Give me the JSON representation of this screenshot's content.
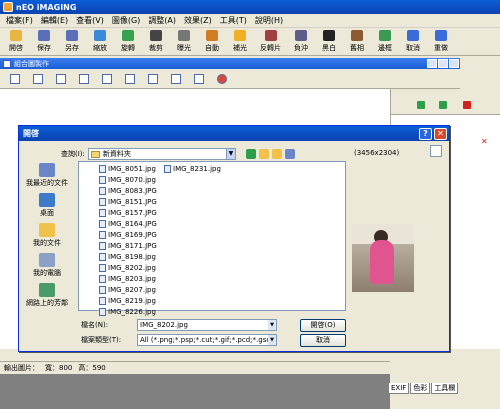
{
  "window": {
    "title": "nEO iMAGING"
  },
  "menu": [
    "檔案(F)",
    "編輯(E)",
    "查看(V)",
    "圖像(G)",
    "調整(A)",
    "效果(Z)",
    "工具(T)",
    "說明(H)"
  ],
  "toolbar": [
    {
      "label": "開啓",
      "icon": "open-folder-icon",
      "color": "#e8b640"
    },
    {
      "label": "保存",
      "icon": "save-icon",
      "color": "#5a6fb8"
    },
    {
      "label": "另存",
      "icon": "save-as-icon",
      "color": "#5a6fb8"
    },
    {
      "label": "縮放",
      "icon": "zoom-icon",
      "color": "#3b8ad9"
    },
    {
      "label": "旋轉",
      "icon": "rotate-icon",
      "color": "#37a24e"
    },
    {
      "label": "裁剪",
      "icon": "crop-icon",
      "color": "#444444"
    },
    {
      "label": "曝光",
      "icon": "exposure-icon",
      "color": "#777777"
    },
    {
      "label": "自動",
      "icon": "auto-icon",
      "color": "#d17d22"
    },
    {
      "label": "補光",
      "icon": "fill-light-icon",
      "color": "#f0b024"
    },
    {
      "label": "反轉片",
      "icon": "slide-film-icon",
      "color": "#a04040"
    },
    {
      "label": "負沖",
      "icon": "cross-process-icon",
      "color": "#5d5d8c"
    },
    {
      "label": "黑白",
      "icon": "black-white-icon",
      "color": "#222222"
    },
    {
      "label": "舊相",
      "icon": "old-photo-icon",
      "color": "#8c5a30"
    },
    {
      "label": "邊框",
      "icon": "border-icon",
      "color": "#3b9a52"
    },
    {
      "label": "取消",
      "icon": "undo-icon",
      "color": "#3b6ad9"
    },
    {
      "label": "重做",
      "icon": "redo-icon",
      "color": "#3b6ad9"
    }
  ],
  "child_window": {
    "title": "組合圖製作"
  },
  "dialog": {
    "title": "開啓",
    "lookin_label": "查詢(I):",
    "folder": "新資料夾",
    "image_size": "(3456x2304)",
    "places": [
      {
        "label": "我最近的文件",
        "icon": "recent-documents-icon",
        "color": "#6a86c8"
      },
      {
        "label": "桌面",
        "icon": "desktop-icon",
        "color": "#3d7ac8"
      },
      {
        "label": "我的文件",
        "icon": "my-documents-icon",
        "color": "#f0c24a"
      },
      {
        "label": "我的電腦",
        "icon": "my-computer-icon",
        "color": "#8aa0c8"
      },
      {
        "label": "網路上的芳鄰",
        "icon": "network-icon",
        "color": "#4a9a6a"
      }
    ],
    "files_col1": [
      "IMG_8051.jpg",
      "IMG_8070.jpg",
      "IMG_8083.JPG",
      "IMG_8151.JPG",
      "IMG_8157.JPG",
      "IMG_8164.JPG",
      "IMG_8169.JPG",
      "IMG_8171.JPG",
      "IMG_8198.jpg",
      "IMG_8202.jpg",
      "IMG_8203.jpg",
      "IMG_8207.jpg",
      "IMG_8219.jpg",
      "IMG_8226.jpg"
    ],
    "files_col2": [
      "IMG_8231.jpg"
    ],
    "filename_label": "檔名(N):",
    "filename_value": "IMG_8202.jpg",
    "filetype_label": "檔案類型(T):",
    "filetype_value": "All (*.png;*.psp;*.cut;*.gif;*.pcd;*.gsc;*.cel;*.g",
    "open_button": "開啓(O)",
    "cancel_button": "取消"
  },
  "statusbar": {
    "label": "輸出圖片：",
    "width": "寬：800",
    "height": "高：590"
  },
  "panel_tabs": [
    "EXIF",
    "色彩",
    "工具欄"
  ]
}
